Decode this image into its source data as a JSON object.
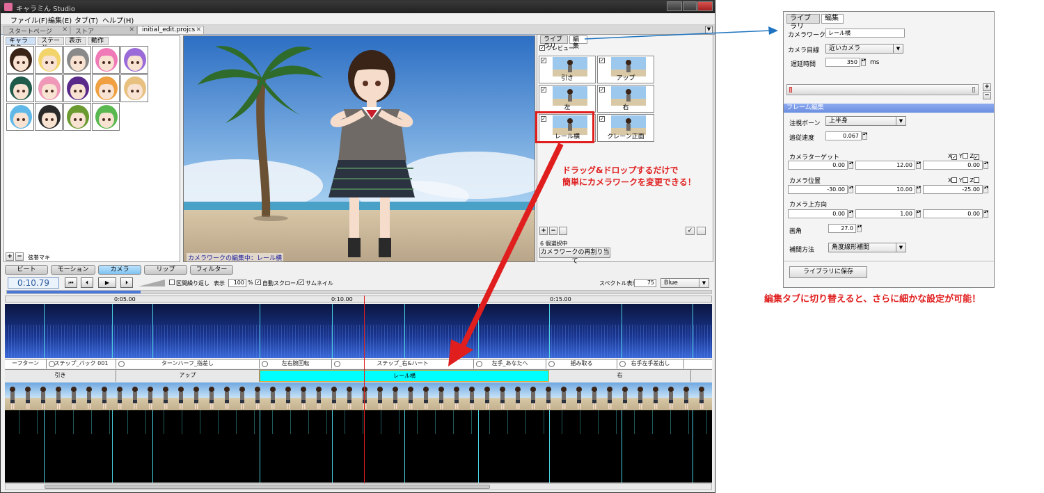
{
  "app": {
    "title": "キャラミん Studio",
    "menu": [
      "ファイル(F)",
      "編集(E)",
      "タブ(T)",
      "ヘルプ(H)"
    ],
    "doc_tabs": [
      "スタートページ",
      "ストア",
      "initial_edit.projcs"
    ]
  },
  "left_panel": {
    "tabs": [
      "キャラクター",
      "ステージ",
      "表示",
      "動作"
    ],
    "selected_name": "弦巻マキ"
  },
  "viewport": {
    "status": "カメラワークの編集中：レール横"
  },
  "right_panel": {
    "tabs": [
      "ライブラリ",
      "編集"
    ],
    "preview_label": "プレビュー",
    "camera_works": [
      "引き",
      "アップ",
      "左",
      "右",
      "レール横",
      "クレーン正面"
    ],
    "selection_count": "6 個選択中",
    "reassign_button": "カメラワークの再割り当て"
  },
  "mode_tabs": [
    "ビート",
    "モーション",
    "カメラ",
    "リップ",
    "フィルター"
  ],
  "transport": {
    "time": "0:10.79",
    "loop_label": "区間繰り返し",
    "display_label": "表示",
    "zoom_value": "100",
    "zoom_unit": "%",
    "auto_scroll_label": "自動スクロール",
    "thumbnail_label": "サムネイル",
    "spectrum_label": "スペクトル表示",
    "spectrum_value": "75",
    "color_scheme": "Blue"
  },
  "ruler": [
    "0:05.00",
    "0:10.00",
    "0:15.00"
  ],
  "motions": [
    "ーフターン",
    "ステップ_バック 001",
    "ターンハーフ_指差し",
    "左右腕回転",
    "ステップ_右&ハート",
    "左手_あなたへ",
    "揺み取る",
    "右手左手差出し"
  ],
  "camera_track": [
    "引き",
    "アップ",
    "レール横",
    "右"
  ],
  "annotations": {
    "drag_drop": [
      "ドラッグ&ドロップするだけで",
      "簡単にカメラワークを変更できる！"
    ],
    "edit_tab": "編集タブに切り替えると、さらに細かな設定が可能！"
  },
  "edit_panel": {
    "tabs": [
      "ライブラリ",
      "編集"
    ],
    "name_label": "カメラワーク名",
    "name_value": "レール横",
    "target_label": "カメラ目線",
    "target_value": "近いカメラ",
    "delay_label": "遅延時間",
    "delay_value": "350",
    "delay_unit": "ms",
    "frame_header": "フレーム編集",
    "bone_label": "注視ボーン",
    "bone_value": "上半身",
    "speed_label": "追従速度",
    "speed_value": "0.067",
    "cam_target_label": "カメラターゲット",
    "cam_target_values": [
      "0.00",
      "12.00",
      "0.00"
    ],
    "cam_pos_label": "カメラ位置",
    "cam_pos_values": [
      "-30.00",
      "10.00",
      "-25.00"
    ],
    "cam_up_label": "カメラ上方向",
    "cam_up_values": [
      "0.00",
      "1.00",
      "0.00"
    ],
    "axis_x": "X",
    "axis_y": "Y",
    "axis_z": "Z",
    "fov_label": "画角",
    "fov_value": "27.0",
    "interp_label": "補間方法",
    "interp_value": "角度線形補間",
    "save_button": "ライブラリに保存"
  },
  "colors": {
    "highlight_red": "#e01e1e",
    "active_tab_blue": "#7ec3f0",
    "camera_segment_cyan": "#00ffff",
    "frame_header_blue": "#6c8fe0"
  }
}
